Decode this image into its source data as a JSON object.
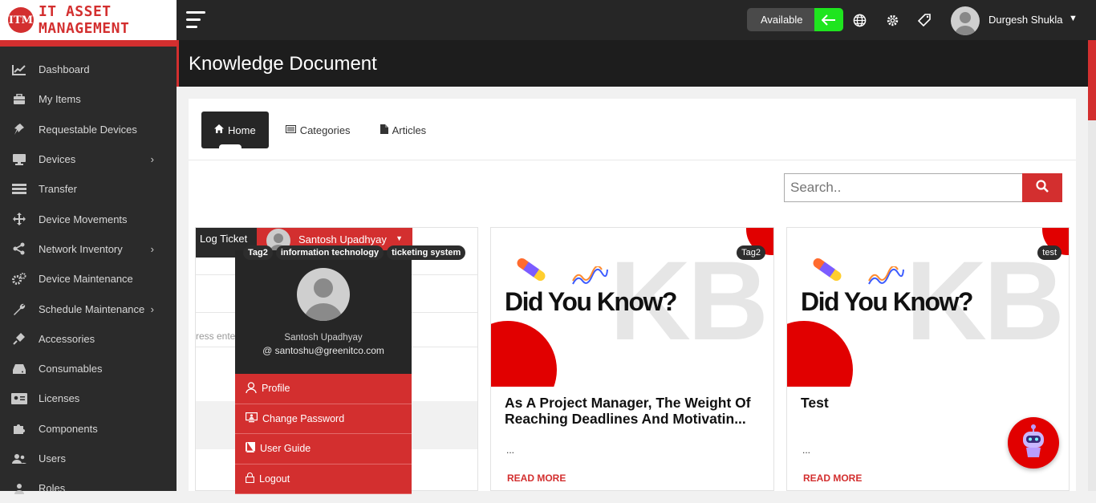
{
  "app": {
    "logo_badge": "ITM",
    "logo_text": "IT ASSET MANAGEMENT",
    "brand_color": "#d32f2f"
  },
  "sidebar": {
    "items": [
      {
        "label": "Dashboard",
        "icon": "chart-line-icon",
        "has_children": false
      },
      {
        "label": "My Items",
        "icon": "briefcase-icon",
        "has_children": false
      },
      {
        "label": "Requestable Devices",
        "icon": "thumbtack-icon",
        "has_children": false
      },
      {
        "label": "Devices",
        "icon": "monitor-icon",
        "has_children": true
      },
      {
        "label": "Transfer",
        "icon": "list-icon",
        "has_children": false
      },
      {
        "label": "Device Movements",
        "icon": "arrows-move-icon",
        "has_children": false
      },
      {
        "label": "Network Inventory",
        "icon": "share-nodes-icon",
        "has_children": true
      },
      {
        "label": "Device Maintenance",
        "icon": "gears-icon",
        "has_children": false
      },
      {
        "label": "Schedule Maintenance",
        "icon": "wrench-icon",
        "has_children": true
      },
      {
        "label": "Accessories",
        "icon": "plug-icon",
        "has_children": false
      },
      {
        "label": "Consumables",
        "icon": "hdd-icon",
        "has_children": false
      },
      {
        "label": "Licenses",
        "icon": "id-card-icon",
        "has_children": false
      },
      {
        "label": "Components",
        "icon": "puzzle-icon",
        "has_children": false
      },
      {
        "label": "Users",
        "icon": "users-icon",
        "has_children": false
      },
      {
        "label": "Roles",
        "icon": "roles-icon",
        "has_children": false
      }
    ]
  },
  "topbar": {
    "status_label": "Available",
    "status_color": "#1ee51e",
    "user_name": "Durgesh Shukla"
  },
  "page": {
    "title": "Knowledge Document"
  },
  "tabs": [
    {
      "label": "Home",
      "icon": "home-icon",
      "active": true
    },
    {
      "label": "Categories",
      "icon": "list-alt-icon",
      "active": false
    },
    {
      "label": "Articles",
      "icon": "file-icon",
      "active": false
    }
  ],
  "search": {
    "placeholder": "Search.."
  },
  "card1": {
    "log_ticket": "Log Ticket",
    "user_name": "Santosh Upadhyay",
    "input_hint": "ress enter",
    "tags": [
      "Tag2",
      "information technology",
      "ticketing system"
    ]
  },
  "dropdown": {
    "name": "Santosh Upadhyay",
    "email": "@ santoshu@greenitco.com",
    "items": [
      {
        "label": "Profile",
        "icon": "user-icon"
      },
      {
        "label": "Change Password",
        "icon": "monitor-user-icon"
      },
      {
        "label": "User Guide",
        "icon": "book-icon"
      },
      {
        "label": "Logout",
        "icon": "lock-icon"
      }
    ]
  },
  "cards": [
    {
      "tag": "Tag2",
      "headline": "Did You Know?",
      "watermark": "KB",
      "title": "As A Project Manager, The Weight Of Reaching Deadlines And Motivatin...",
      "excerpt": "...",
      "read_more": "READ MORE"
    },
    {
      "tag": "test",
      "headline": "Did You Know?",
      "watermark": "KB",
      "title": "Test",
      "excerpt": "...",
      "read_more": "READ MORE"
    }
  ]
}
